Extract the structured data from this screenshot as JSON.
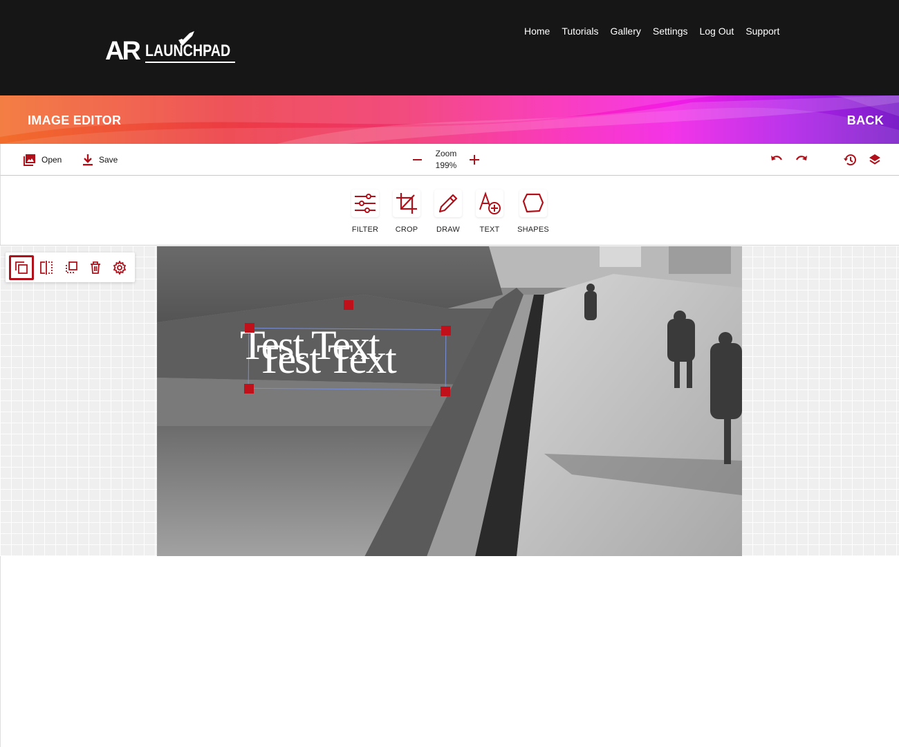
{
  "header": {
    "logo": {
      "ar": "AR",
      "name": "LAUNCHPAD"
    },
    "nav": [
      "Home",
      "Tutorials",
      "Gallery",
      "Settings",
      "Log Out",
      "Support"
    ]
  },
  "banner": {
    "title": "IMAGE EDITOR",
    "back": "BACK"
  },
  "toolbar": {
    "open": "Open",
    "save": "Save",
    "zoom_label": "Zoom",
    "zoom_value": "199%"
  },
  "tools": [
    {
      "label": "FILTER",
      "icon": "sliders-icon"
    },
    {
      "label": "CROP",
      "icon": "crop-icon"
    },
    {
      "label": "DRAW",
      "icon": "pencil-icon"
    },
    {
      "label": "TEXT",
      "icon": "text-add-icon"
    },
    {
      "label": "SHAPES",
      "icon": "polygon-icon"
    }
  ],
  "side_tools": [
    "duplicate-icon",
    "flip-icon",
    "arrange-icon",
    "trash-icon",
    "settings-gear-icon"
  ],
  "canvas": {
    "text_object": "Test Text"
  },
  "colors": {
    "accent": "#b0101a",
    "header_bg": "#161616",
    "selection_outline": "#7b8fd6"
  }
}
